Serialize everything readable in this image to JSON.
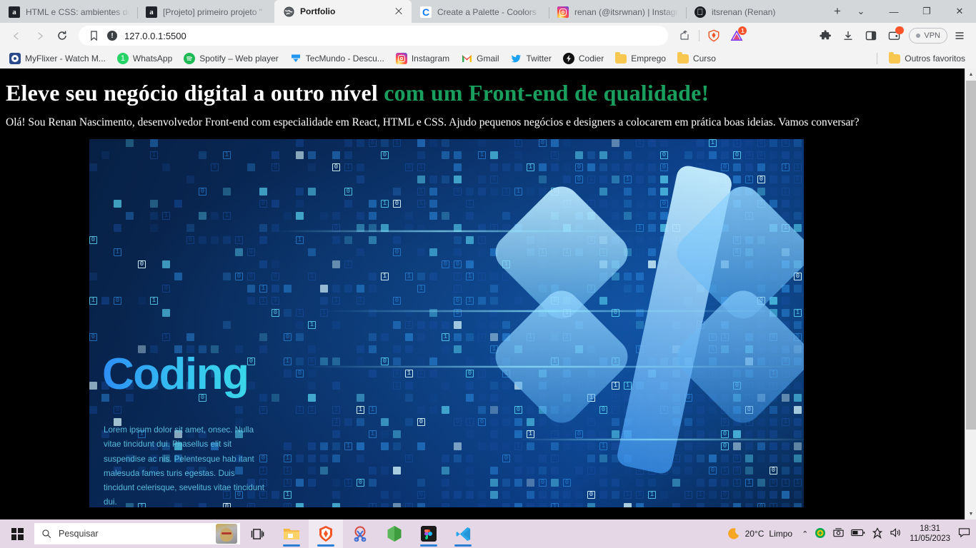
{
  "browser": {
    "tabs": [
      {
        "title": "HTML e CSS: ambientes de",
        "favicon": "alura-icon",
        "active": false
      },
      {
        "title": "[Projeto] primeiro projeto \"",
        "favicon": "alura-icon",
        "active": false
      },
      {
        "title": "Portfolio",
        "favicon": "globe-icon",
        "active": true
      },
      {
        "title": "Create a Palette - Coolors",
        "favicon": "coolors-icon",
        "active": false
      },
      {
        "title": "renan (@itsrwnan) | Instagram",
        "favicon": "instagram-icon",
        "active": false
      },
      {
        "title": "itsrenan (Renan)",
        "favicon": "github-icon",
        "active": false
      }
    ],
    "new_tab_label": "+",
    "window_controls": {
      "tab_search": "⌄",
      "minimize": "—",
      "maximize": "❐",
      "close": "✕"
    },
    "toolbar": {
      "back": "◁",
      "forward": "▷",
      "reload": "⟳",
      "bookmark_this": "bookmark",
      "url": "127.0.0.1:5500",
      "site_info": "!",
      "share": "share",
      "brave_shields": "brave-lion",
      "extension_badge": "1",
      "vpn_label": "VPN"
    },
    "bookmarks": [
      {
        "label": "MyFlixer - Watch M...",
        "icon": "myflixer-icon"
      },
      {
        "label": "WhatsApp",
        "icon": "whatsapp-icon"
      },
      {
        "label": "Spotify – Web player",
        "icon": "spotify-icon"
      },
      {
        "label": "TecMundo - Descu...",
        "icon": "tecmundo-icon"
      },
      {
        "label": "Instagram",
        "icon": "instagram-icon"
      },
      {
        "label": "Gmail",
        "icon": "gmail-icon"
      },
      {
        "label": "Twitter",
        "icon": "twitter-icon"
      },
      {
        "label": "Codier",
        "icon": "codier-icon"
      },
      {
        "label": "Emprego",
        "icon": "folder-icon"
      },
      {
        "label": "Curso",
        "icon": "folder-icon"
      }
    ],
    "bookmarks_other": {
      "label": "Outros favoritos",
      "icon": "folder-icon"
    }
  },
  "page": {
    "headline_main": "Eleve seu negócio digital a outro nível",
    "headline_accent": "com um Front-end de qualidade!",
    "paragraph": "Olá! Sou Renan Nascimento, desenvolvedor Front-end com especialidade em React, HTML e CSS. Ajudo pequenos negócios e designers a colocarem em prática boas ideias. Vamos conversar?",
    "accent_color": "#1a9e5d",
    "background_color": "#000000",
    "banner": {
      "title": "Coding",
      "body": "Lorem ipsum dolor sit amet, onsec. Nulla vitae tincidunt dui. Phasellus elit sit suspendise ac nis. Pelentesque hab itant malesuda fames  turis egestas. Duis tincidunt celerisque, sevelitus vitae tincidunt dui.",
      "symbol": "</>"
    }
  },
  "scrollbar": {
    "up": "▲",
    "down": "▼"
  },
  "taskbar": {
    "start": "start-button",
    "search_placeholder": "Pesquisar",
    "task_view": "task-view",
    "apps": [
      {
        "name": "file-explorer",
        "running": true
      },
      {
        "name": "brave-browser",
        "running": true,
        "active": true
      },
      {
        "name": "snipping-tool",
        "running": false
      },
      {
        "name": "nodejs",
        "running": false
      },
      {
        "name": "figma",
        "running": true
      },
      {
        "name": "vs-code",
        "running": true
      }
    ],
    "weather": {
      "temperature": "20°C",
      "condition": "Limpo"
    },
    "tray_expand": "⌃",
    "time": "18:31",
    "date": "11/05/2023"
  }
}
